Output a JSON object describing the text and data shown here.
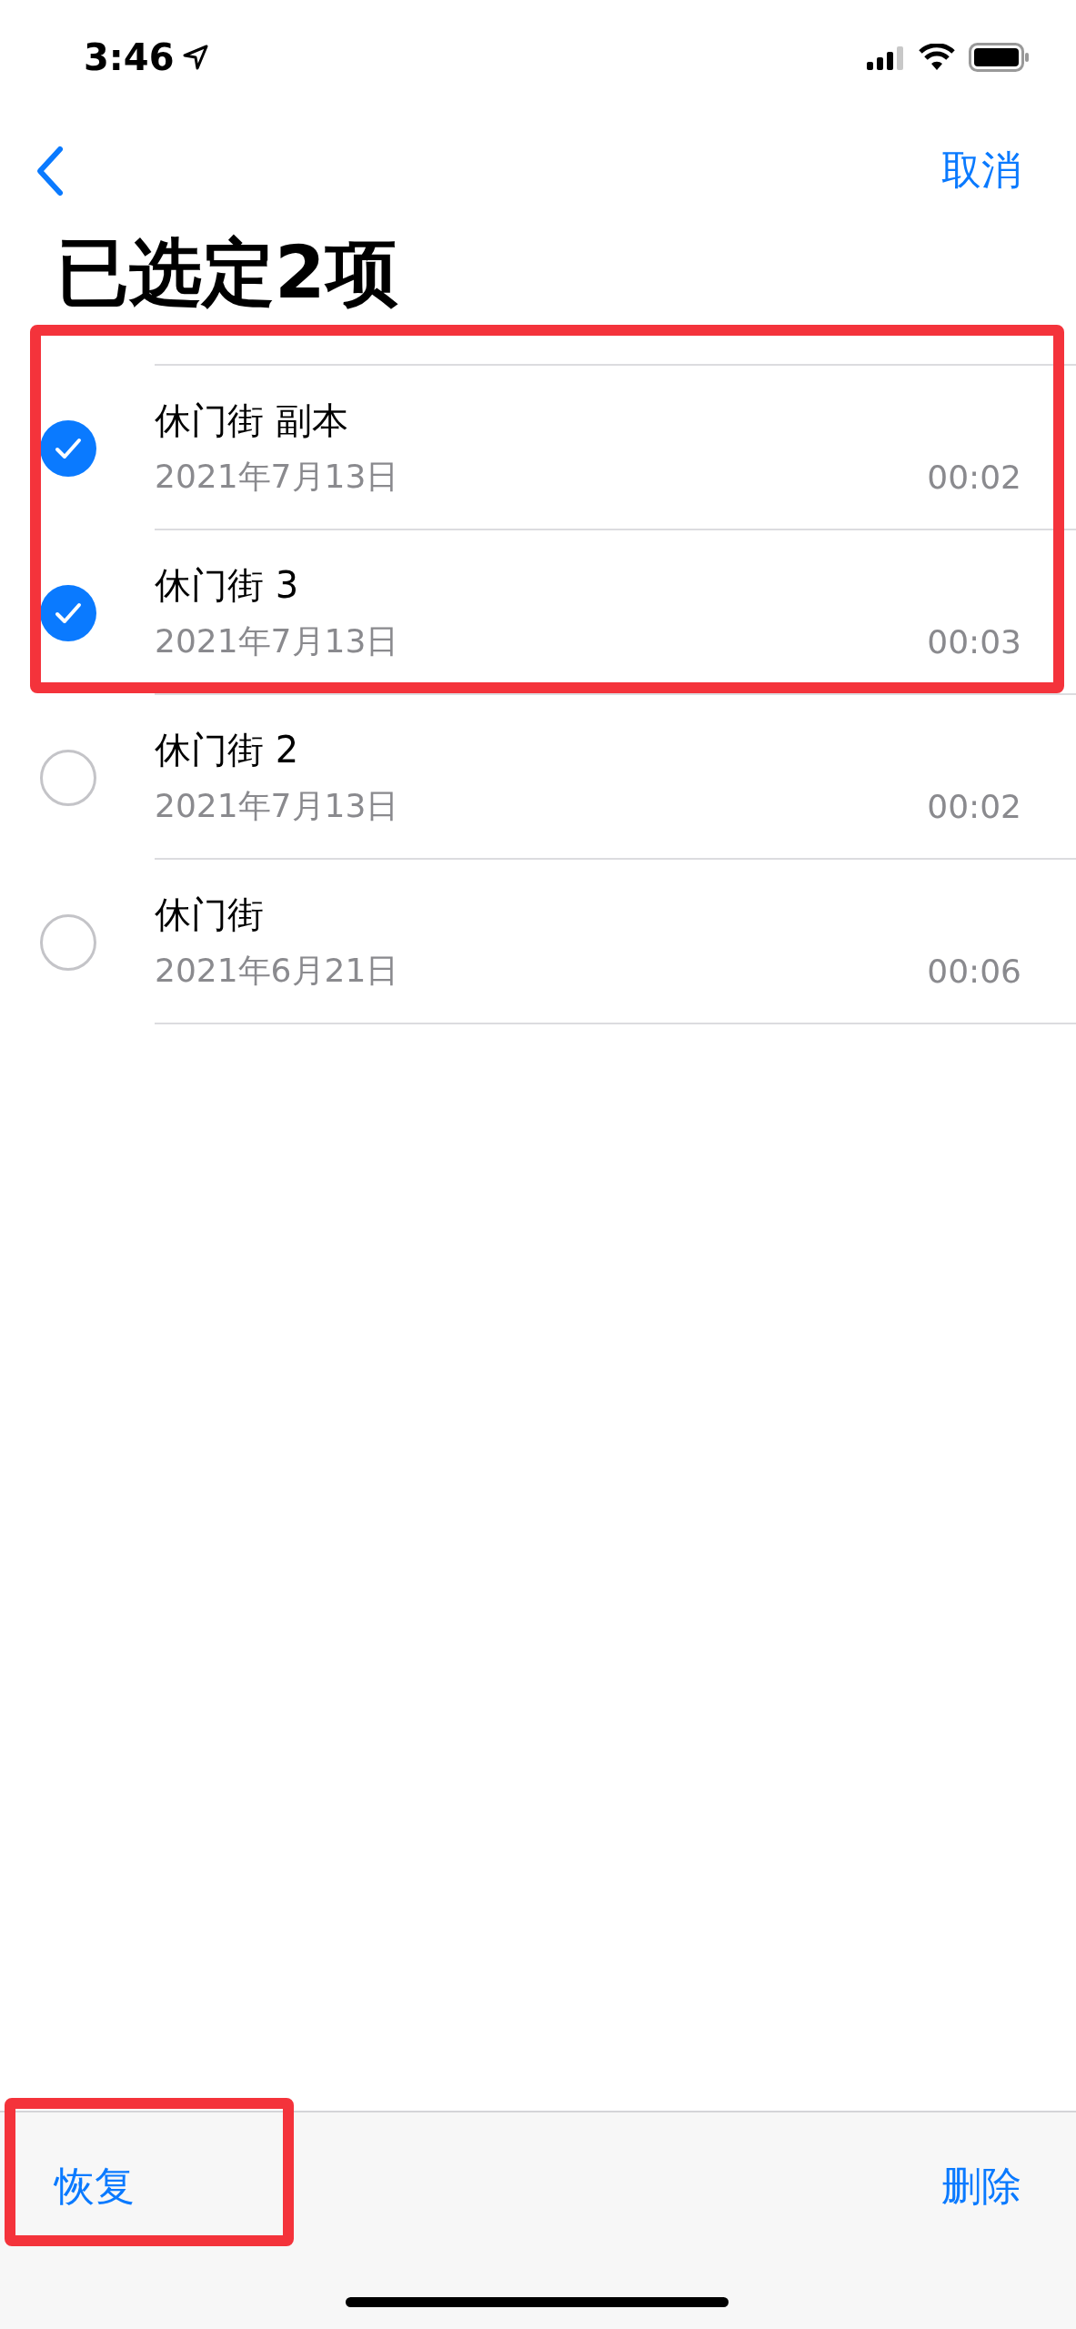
{
  "status_bar": {
    "time": "3:46"
  },
  "nav": {
    "cancel": "取消"
  },
  "title": "已选定2项",
  "recordings": [
    {
      "title": "休门街 副本",
      "date": "2021年7月13日",
      "duration": "00:02",
      "selected": true
    },
    {
      "title": "休门街 3",
      "date": "2021年7月13日",
      "duration": "00:03",
      "selected": true
    },
    {
      "title": "休门街 2",
      "date": "2021年7月13日",
      "duration": "00:02",
      "selected": false
    },
    {
      "title": "休门街",
      "date": "2021年6月21日",
      "duration": "00:06",
      "selected": false
    }
  ],
  "toolbar": {
    "recover": "恢复",
    "delete": "删除"
  }
}
